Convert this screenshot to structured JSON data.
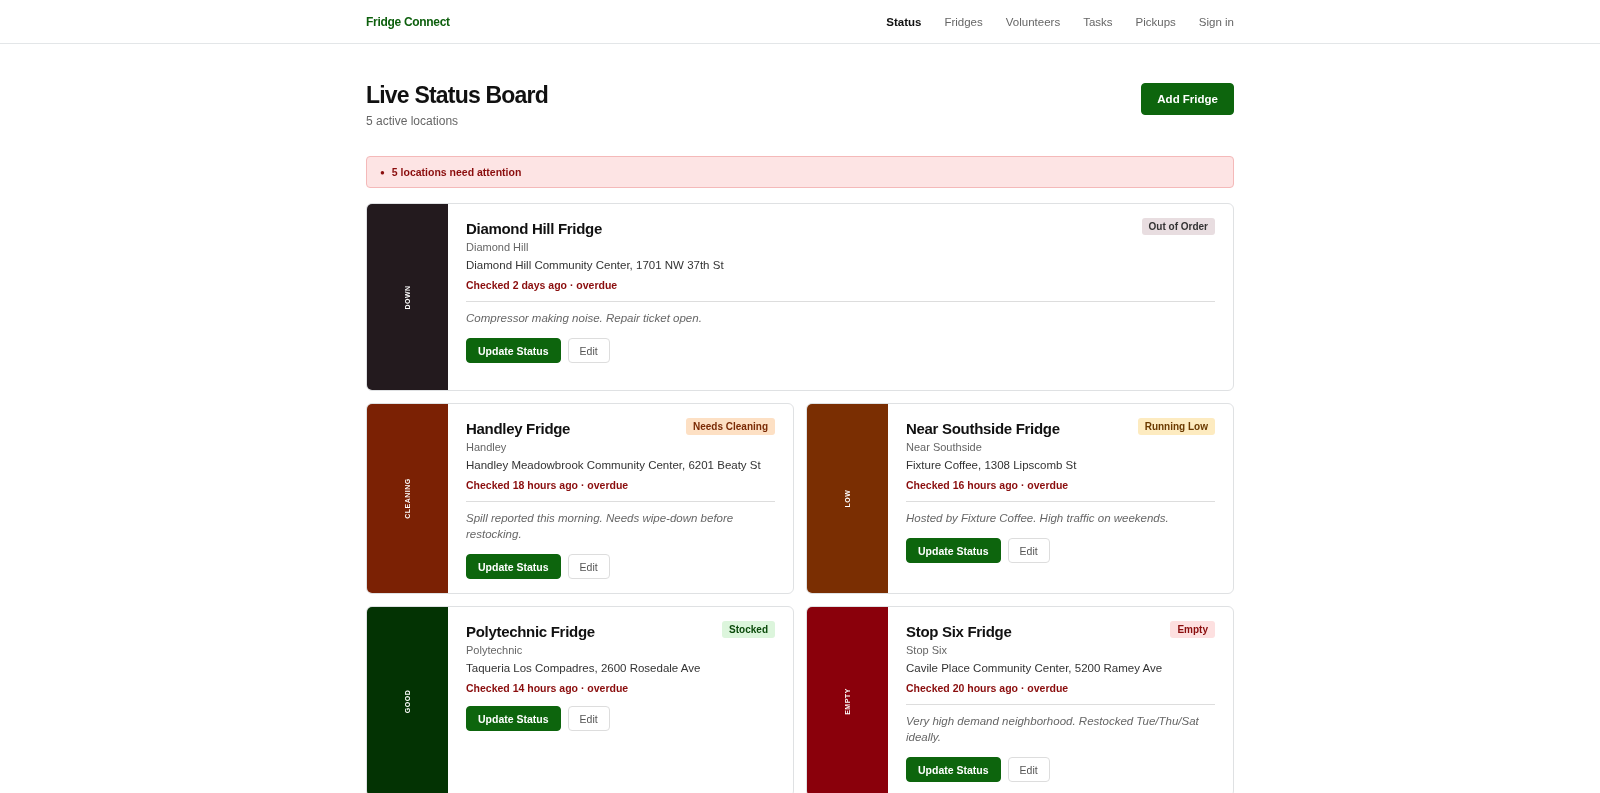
{
  "nav": {
    "brand": "Fridge Connect",
    "links": [
      {
        "label": "Status",
        "selected": true
      },
      {
        "label": "Fridges",
        "selected": false
      },
      {
        "label": "Volunteers",
        "selected": false
      },
      {
        "label": "Tasks",
        "selected": false
      },
      {
        "label": "Pickups",
        "selected": false
      },
      {
        "label": "Sign in",
        "selected": false
      }
    ]
  },
  "header": {
    "title": "Live Status Board",
    "subtitle": "5 active locations",
    "button": "Add Fridge"
  },
  "alert": {
    "bullet": "●",
    "text": "5 locations need attention"
  },
  "fridges": [
    {
      "name": "Diamond Hill Fridge",
      "neighborhood": "Diamond Hill",
      "address": "Diamond Hill Community Center, 1701 NW 37th St",
      "checked": "Checked 2 days ago · overdue",
      "note": "Compressor making noise. Repair ticket open.",
      "strip": "DOWN",
      "color": "#231a1e",
      "badge": "Out of Order",
      "kind": "down",
      "wide": true,
      "buttons": [
        "Update Status",
        "Edit"
      ]
    },
    {
      "name": "Handley Fridge",
      "neighborhood": "Handley",
      "address": "Handley Meadowbrook Community Center, 6201 Beaty St",
      "checked": "Checked 18 hours ago · overdue",
      "note": "Spill reported this morning. Needs wipe-down before restocking.",
      "strip": "CLEANING",
      "color": "#7b2104",
      "badge": "Needs Cleaning",
      "kind": "cleaning",
      "wide": false,
      "buttons": [
        "Update Status",
        "Edit"
      ]
    },
    {
      "name": "Near Southside Fridge",
      "neighborhood": "Near Southside",
      "address": "Fixture Coffee, 1308 Lipscomb St",
      "checked": "Checked 16 hours ago · overdue",
      "note": "Hosted by Fixture Coffee. High traffic on weekends.",
      "strip": "LOW",
      "color": "#7a2e02",
      "badge": "Running Low",
      "kind": "low",
      "wide": false,
      "buttons": [
        "Update Status",
        "Edit"
      ]
    },
    {
      "name": "Polytechnic Fridge",
      "neighborhood": "Polytechnic",
      "address": "Taqueria Los Compadres, 2600 Rosedale Ave",
      "checked": "Checked 14 hours ago · overdue",
      "strip": "GOOD",
      "color": "#033303",
      "badge": "Stocked",
      "kind": "good",
      "wide": false,
      "buttons": [
        "Update Status",
        "Edit"
      ]
    },
    {
      "name": "Stop Six Fridge",
      "neighborhood": "Stop Six",
      "address": "Cavile Place Community Center, 5200 Ramey Ave",
      "checked": "Checked 20 hours ago · overdue",
      "note": "Very high demand neighborhood. Restocked Tue/Thu/Sat ideally.",
      "strip": "EMPTY",
      "color": "#8a000b",
      "badge": "Empty",
      "kind": "empty",
      "wide": false,
      "buttons": [
        "Update Status",
        "Edit"
      ]
    }
  ]
}
